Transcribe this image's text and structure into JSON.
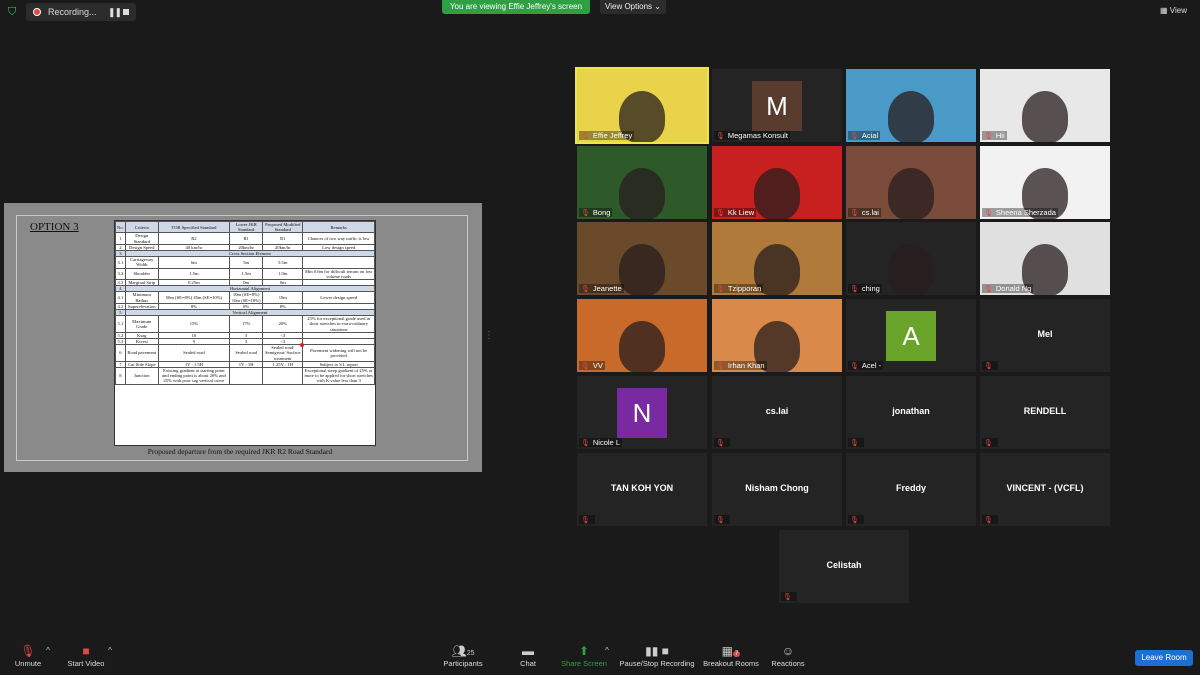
{
  "topbar": {
    "recording_label": "Recording...",
    "viewing_banner": "You are viewing Effie Jeffrey's screen",
    "view_options": "View Options",
    "view": "View"
  },
  "slide": {
    "heading": "OPTION 3",
    "caption": "Proposed departure from the required JKR R2 Road Standard",
    "table": {
      "headers": [
        "No.",
        "Criteria",
        "TOR Specified Standard",
        "Lower JKR Standard",
        "Proposed Modified Standard",
        "Remarks"
      ],
      "rows": [
        [
          "1",
          "Design Standard",
          "R2",
          "R1",
          "R1",
          "Chances of two way traffic is low"
        ],
        [
          "2",
          "Design Speed",
          "40 km/hr",
          "20km/hr",
          "20km/hr",
          "Low design speed"
        ],
        [
          "3",
          "Cross Section Element"
        ],
        [
          "3.1",
          "Carriageway Width",
          "6m",
          "5m",
          "5.5m",
          ""
        ],
        [
          "3.2",
          "Shoulder",
          "1.5m",
          "1.5m",
          "1.0m",
          "Min 0.6m for difficult terrain on low volume roads"
        ],
        [
          "3.3",
          "Marginal Strip",
          "0.25m",
          "0m",
          "0m",
          ""
        ],
        [
          "4",
          "Horizontal Alignment"
        ],
        [
          "4.1",
          "Minimum Radius",
          "50m (SE=8%) 45m (SE=10%)",
          "10m (SE=8%) 10m (SE=10%)",
          "10m",
          "Lower design speed"
        ],
        [
          "4.2",
          "Superelevation",
          "8%",
          "8%",
          "8%",
          ""
        ],
        [
          "5",
          "Vertical Alignment"
        ],
        [
          "5.1",
          "Maximum Grade",
          "15%",
          "17%",
          "20%",
          "25% for exceptional grade used in short stretches in extra-ordinary situations"
        ],
        [
          "5.2",
          "Ksag",
          "10",
          "3",
          "<3",
          ""
        ],
        [
          "5.3",
          "Kcrest",
          "9",
          "3",
          "<3",
          ""
        ],
        [
          "6",
          "Road pavement",
          "Sealed road",
          "Sealed road",
          "Sealed road/ Semigrout/ Surface treatment",
          "Pavement widening will not be provided"
        ],
        [
          "7",
          "Cut Side Slope",
          "1V : 1.5H",
          "1V : 1H",
          "1.25V : 1H",
          "Subject to S.I. report"
        ],
        [
          "8",
          "Junction",
          "Existing gradient at starting point and ending point is about 20% and 25% with poor sag vertical curve",
          "",
          "",
          "Exceptional steep gradient of 25% or more to be applied for short stretches with K value less than 3"
        ]
      ]
    }
  },
  "participants": [
    {
      "name": "Effie Jeffrey",
      "type": "video"
    },
    {
      "name": "Megamas Konsult",
      "type": "avatar",
      "letter": "M",
      "color": "#5a3c2e"
    },
    {
      "name": "Acial",
      "type": "video"
    },
    {
      "name": "Hii",
      "type": "video"
    },
    {
      "name": "Bong",
      "type": "video"
    },
    {
      "name": "Kk Liew",
      "type": "video"
    },
    {
      "name": "cs.lai",
      "type": "video"
    },
    {
      "name": "Sheena Sherzada",
      "type": "video"
    },
    {
      "name": "Jeanette",
      "type": "video"
    },
    {
      "name": "Tzipporan",
      "type": "video"
    },
    {
      "name": "ching",
      "type": "video"
    },
    {
      "name": "Donald Ng",
      "type": "video"
    },
    {
      "name": "VV",
      "type": "video"
    },
    {
      "name": "Irhan Khan",
      "type": "video"
    },
    {
      "name": "Acel -",
      "type": "avatar",
      "letter": "A",
      "color": "#6aa329"
    },
    {
      "name": "Mel",
      "type": "name"
    },
    {
      "name": "Nicole L",
      "type": "avatar",
      "letter": "N",
      "color": "#7a2aa0"
    },
    {
      "name": "cs.lai",
      "type": "name"
    },
    {
      "name": "jonathan",
      "type": "name"
    },
    {
      "name": "RENDELL",
      "type": "name"
    },
    {
      "name": "TAN KOH YON",
      "type": "name"
    },
    {
      "name": "Nisham Chong",
      "type": "name"
    },
    {
      "name": "Freddy",
      "type": "name"
    },
    {
      "name": "VINCENT - (VCFL)",
      "type": "name"
    },
    {
      "name": "Celistah",
      "type": "name"
    }
  ],
  "toolbar": {
    "unmute": "Unmute",
    "start_video": "Start Video",
    "participants": "Participants",
    "participants_count": "25",
    "chat": "Chat",
    "share_screen": "Share Screen",
    "pause_stop_recording": "Pause/Stop Recording",
    "breakout_rooms": "Breakout Rooms",
    "breakout_badge": "7",
    "reactions": "Reactions",
    "leave_room": "Leave Room"
  },
  "colors": {
    "accent_green": "#2ea043",
    "leave_blue": "#1d6fd1",
    "mute_red": "#e04848"
  }
}
